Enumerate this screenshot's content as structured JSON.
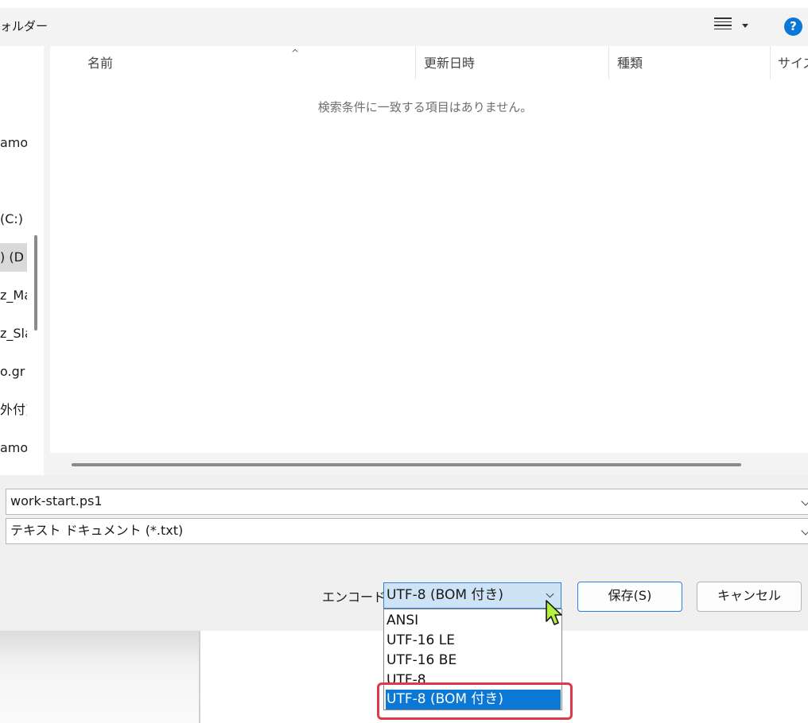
{
  "toolbar": {
    "folder_label": "ォルダー",
    "view_icon": "list-view-icon",
    "help_label": "?"
  },
  "nav": {
    "items": [
      {
        "label": "amot"
      },
      {
        "label": "(C:)"
      },
      {
        "label": ") (D"
      },
      {
        "label": "z_Ma"
      },
      {
        "label": "z_Sla"
      },
      {
        "label": "o.gr"
      },
      {
        "label": "外付)"
      },
      {
        "label": "amoti"
      }
    ]
  },
  "file_list": {
    "columns": [
      "名前",
      "更新日時",
      "種類",
      "サイズ"
    ],
    "empty_message": "検索条件に一致する項目はありません。"
  },
  "filename": {
    "value": "work-start.ps1"
  },
  "filetype": {
    "value": "テキスト ドキュメント (*.txt)"
  },
  "encoding": {
    "label": "エンコード:",
    "selected": "UTF-8 (BOM 付き)",
    "options": [
      "ANSI",
      "UTF-16 LE",
      "UTF-16 BE",
      "UTF-8",
      "UTF-8 (BOM 付き)"
    ]
  },
  "buttons": {
    "save": "保存(S)",
    "cancel": "キャンセル"
  },
  "colors": {
    "accent": "#0a78d4",
    "highlight": "#dc3a48",
    "cursor": "#b5f03c"
  }
}
